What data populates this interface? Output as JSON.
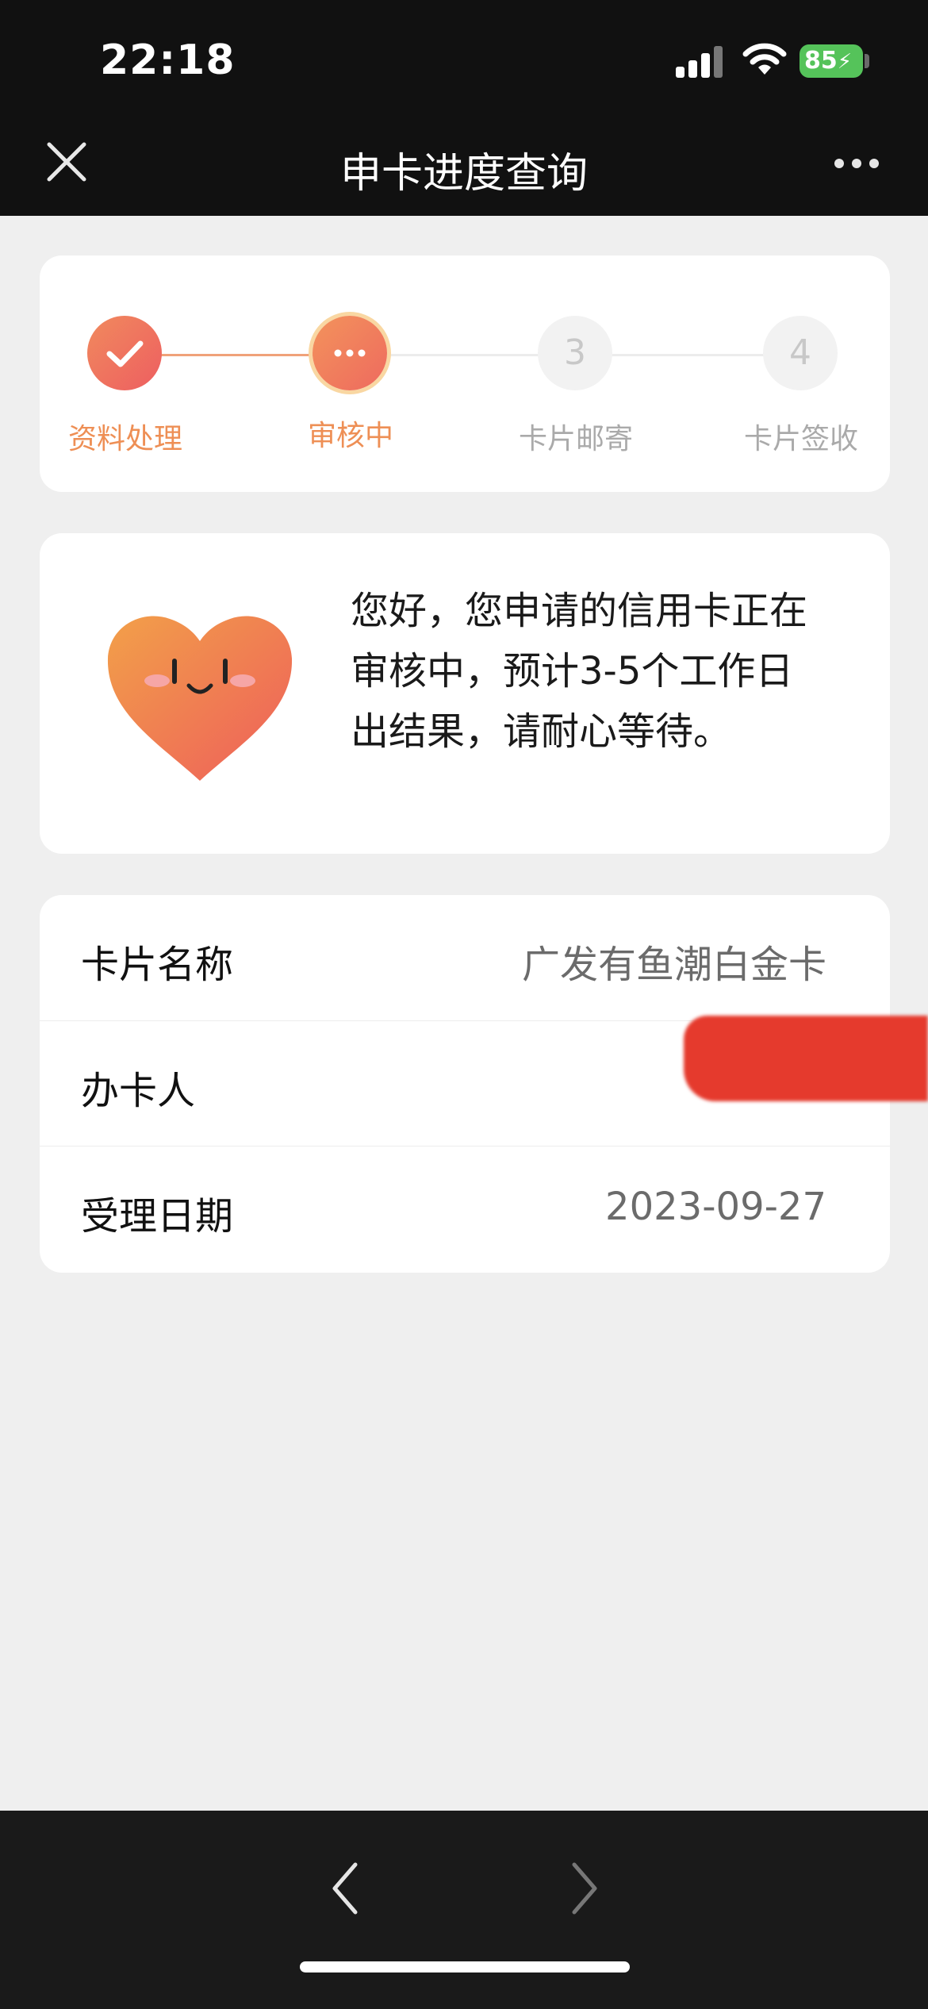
{
  "status_bar": {
    "time": "22:18",
    "battery_level": "85"
  },
  "nav": {
    "title": "申卡进度查询",
    "close_icon": "close-icon",
    "more_icon": "more-icon"
  },
  "progress": {
    "steps": [
      {
        "label": "资料处理",
        "state": "done",
        "marker": "check-icon"
      },
      {
        "label": "审核中",
        "state": "current",
        "marker": "dots-icon"
      },
      {
        "label": "卡片邮寄",
        "state": "pending",
        "marker": "3"
      },
      {
        "label": "卡片签收",
        "state": "pending",
        "marker": "4"
      }
    ]
  },
  "message": {
    "text": "您好，您申请的信用卡正在审核中，预计3-5个工作日出结果，请耐心等待。",
    "illustration": "smiling-heart-icon"
  },
  "info": {
    "rows": [
      {
        "label": "卡片名称",
        "value": "广发有鱼潮白金卡"
      },
      {
        "label": "办卡人",
        "value": ""
      },
      {
        "label": "受理日期",
        "value": "2023-09-27"
      }
    ]
  },
  "bottom_bar": {
    "back_icon": "chevron-left-icon",
    "forward_icon": "chevron-right-icon"
  },
  "colors": {
    "accent": "#f0765a",
    "accent_text": "#ee8f55",
    "pending_text": "#aaaaaa",
    "redaction": "#e53a2d",
    "bar_dark": "#111111"
  }
}
